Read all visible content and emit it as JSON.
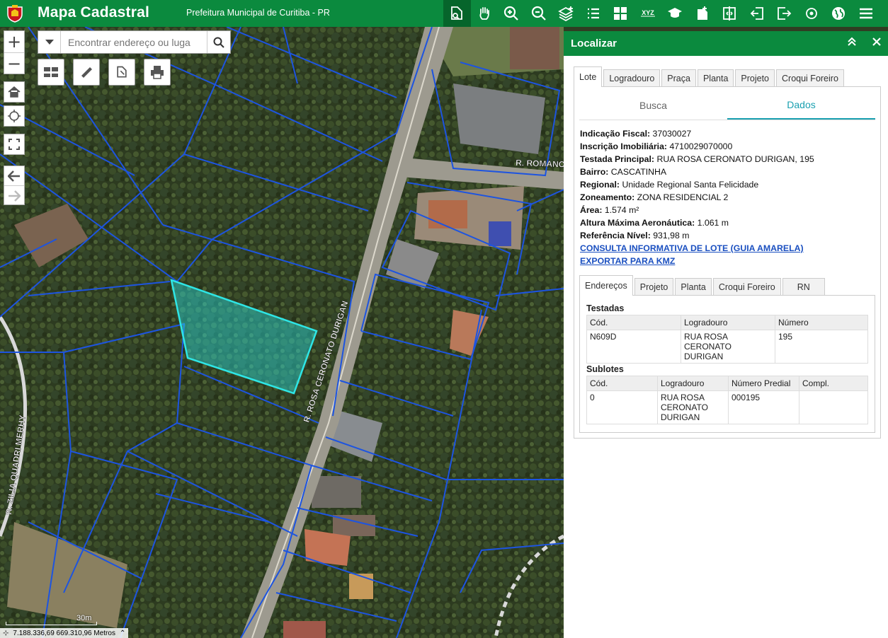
{
  "header": {
    "title": "Mapa Cadastral",
    "subtitle": "Prefeitura Municipal de Curitiba - PR",
    "brand_color": "#0b8a3e",
    "tools": [
      {
        "icon": "identify-icon",
        "active": true
      },
      {
        "icon": "pan-hand-icon"
      },
      {
        "icon": "zoom-in-icon"
      },
      {
        "icon": "zoom-out-icon"
      },
      {
        "icon": "layers-add-icon"
      },
      {
        "icon": "legend-list-icon"
      },
      {
        "icon": "grid-icon"
      },
      {
        "icon": "xyz-coordinates-icon",
        "text": "XYZ"
      },
      {
        "icon": "graduation-cap-icon"
      },
      {
        "icon": "document-add-icon"
      },
      {
        "icon": "compare-split-icon"
      },
      {
        "icon": "import-icon"
      },
      {
        "icon": "export-icon"
      },
      {
        "icon": "location-target-icon"
      },
      {
        "icon": "globe-icon"
      },
      {
        "icon": "menu-icon"
      }
    ]
  },
  "map": {
    "search_placeholder": "Encontrar endereço ou luga",
    "street_labels": [
      "R. ROSA CERONATO DURIGAN",
      "R. ROMANO",
      "R. ZILIA QUADRI MERHY"
    ],
    "scale_label": "30m",
    "coordinates": "7.188.336,69 669.310,96 Metros",
    "selection_color": "#2ee6e6",
    "parcel_line_color": "#1d54e0"
  },
  "panel": {
    "title": "Localizar",
    "tabs": [
      "Lote",
      "Logradouro",
      "Praça",
      "Planta",
      "Projeto",
      "Croqui Foreiro"
    ],
    "subtabs": [
      "Busca",
      "Dados"
    ],
    "fields": [
      {
        "label": "Indicação Fiscal:",
        "value": "37030027"
      },
      {
        "label": "Inscrição Imobiliária:",
        "value": "4710029070000"
      },
      {
        "label": "Testada Principal:",
        "value": "RUA ROSA CERONATO DURIGAN, 195"
      },
      {
        "label": "Bairro:",
        "value": "CASCATINHA"
      },
      {
        "label": "Regional:",
        "value": "Unidade Regional Santa Felicidade"
      },
      {
        "label": "Zoneamento:",
        "value": "ZONA RESIDENCIAL 2"
      },
      {
        "label": "Área:",
        "value": "1.574 m²"
      },
      {
        "label": "Altura Máxima Aeronáutica:",
        "value": "1.061 m"
      },
      {
        "label": "Referência Nível:",
        "value": "931,98 m"
      }
    ],
    "links": [
      "CONSULTA INFORMATIVA DE LOTE (GUIA AMARELA)",
      "EXPORTAR PARA KMZ"
    ],
    "detail_tabs": [
      "Endereços",
      "Projeto",
      "Planta",
      "Croqui Foreiro",
      "RN"
    ],
    "testadas": {
      "title": "Testadas",
      "headers": [
        "Cód.",
        "Logradouro",
        "Número"
      ],
      "rows": [
        [
          "N609D",
          "RUA ROSA CERONATO DURIGAN",
          "195"
        ]
      ]
    },
    "sublotes": {
      "title": "Sublotes",
      "headers": [
        "Cód.",
        "Logradouro",
        "Número Predial",
        "Compl."
      ],
      "rows": [
        [
          "0",
          "RUA ROSA CERONATO DURIGAN",
          "000195",
          ""
        ]
      ]
    }
  }
}
